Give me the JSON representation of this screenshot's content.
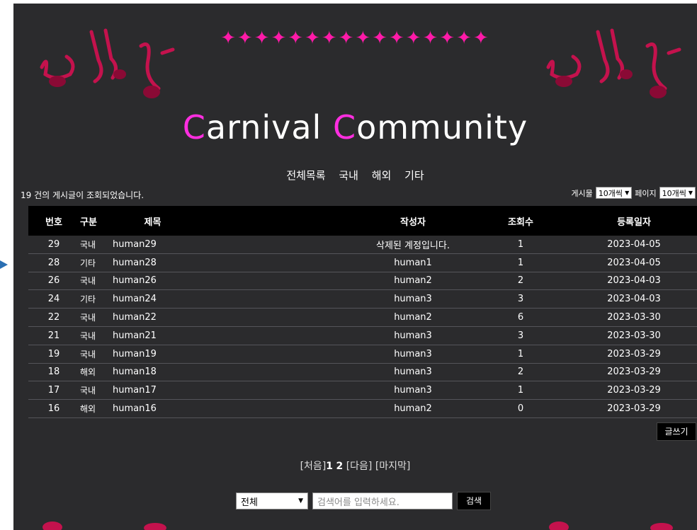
{
  "site": {
    "title_parts": [
      "C",
      "arnival ",
      "C",
      "ommunity"
    ],
    "stars": "✦✦✦✦✦✦✦✦✦✦✦✦✦✦✦✦"
  },
  "categories": [
    "전체목록",
    "국내",
    "해외",
    "기타"
  ],
  "summary": "19 건의 게시글이 조회되었습니다.",
  "selectors": {
    "posts_label": "게시물",
    "posts_value": "10개씩",
    "pages_label": "페이지",
    "pages_value": "10개씩"
  },
  "table": {
    "headers": {
      "no": "번호",
      "category": "구분",
      "title": "제목",
      "writer": "작성자",
      "views": "조회수",
      "date": "등록일자"
    },
    "rows": [
      {
        "no": "29",
        "category": "국내",
        "title": "human29",
        "writer": "삭제된 계정입니다.",
        "views": "1",
        "date": "2023-04-05"
      },
      {
        "no": "28",
        "category": "기타",
        "title": "human28",
        "writer": "human1",
        "views": "1",
        "date": "2023-04-05"
      },
      {
        "no": "26",
        "category": "국내",
        "title": "human26",
        "writer": "human2",
        "views": "2",
        "date": "2023-04-03"
      },
      {
        "no": "24",
        "category": "기타",
        "title": "human24",
        "writer": "human3",
        "views": "3",
        "date": "2023-04-03"
      },
      {
        "no": "22",
        "category": "국내",
        "title": "human22",
        "writer": "human2",
        "views": "6",
        "date": "2023-03-30"
      },
      {
        "no": "21",
        "category": "국내",
        "title": "human21",
        "writer": "human3",
        "views": "3",
        "date": "2023-03-30"
      },
      {
        "no": "19",
        "category": "국내",
        "title": "human19",
        "writer": "human3",
        "views": "1",
        "date": "2023-03-29"
      },
      {
        "no": "18",
        "category": "해외",
        "title": "human18",
        "writer": "human3",
        "views": "2",
        "date": "2023-03-29"
      },
      {
        "no": "17",
        "category": "국내",
        "title": "human17",
        "writer": "human3",
        "views": "1",
        "date": "2023-03-29"
      },
      {
        "no": "16",
        "category": "해외",
        "title": "human16",
        "writer": "human2",
        "views": "0",
        "date": "2023-03-29"
      }
    ]
  },
  "write_button": "글쓰기",
  "paging": {
    "first": "[처음]",
    "pages": [
      "1",
      "2"
    ],
    "next": "[다음]",
    "last": "[마지막]"
  },
  "search": {
    "scope": "전체",
    "placeholder": "검색어를 입력하세요.",
    "button": "검색"
  },
  "colors": {
    "background": "#2b2b2d",
    "accent": "#ff2ee0",
    "stars": "#ff1aa8",
    "header_bg": "#000000"
  }
}
